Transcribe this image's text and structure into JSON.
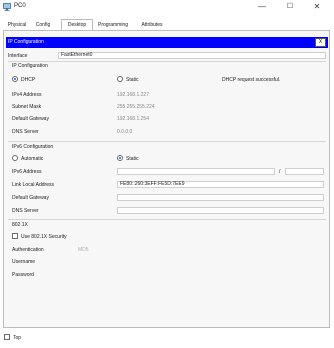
{
  "window": {
    "title": "PC0",
    "minimize": "—",
    "maximize": "☐",
    "close": "✕"
  },
  "tabs": [
    "Physical",
    "Config",
    "Desktop",
    "Programming",
    "Attributes"
  ],
  "ip_config": {
    "header": "IP Configuration",
    "close_label": "X",
    "interface_label": "Interface",
    "interface_value": "FastEthernet0",
    "ipv4_section": "IP Configuration",
    "dhcp_label": "DHCP",
    "static_label": "Static",
    "dhcp_status": "DHCP request successful.",
    "ipv4_address_label": "IPv4 Address",
    "ipv4_address_value": "192.168.1.227",
    "subnet_mask_label": "Subnet Mask",
    "subnet_mask_value": "255.255.255.224",
    "default_gateway_label": "Default Gateway",
    "default_gateway_value": "192.168.1.254",
    "dns_server_label": "DNS Server",
    "dns_server_value": "0.0.0.0",
    "ipv6_section": "IPv6 Configuration",
    "automatic_label": "Automatic",
    "static6_label": "Static",
    "ipv6_address_label": "IPv6 Address",
    "ipv6_address_value": "",
    "prefix_separator": "/",
    "prefix_value": "",
    "link_local_label": "Link Local Address",
    "link_local_value": "FE80::260:3EFF:FE5D:7EE9",
    "gateway6_label": "Default Gateway",
    "gateway6_value": "",
    "dns6_label": "DNS Server",
    "dns6_value": "",
    "dot1x_section": "802.1X",
    "use_dot1x_label": "Use 802.1X Security",
    "authentication_label": "Authentication",
    "authentication_value": "MD5",
    "username_label": "Username",
    "password_label": "Password"
  },
  "footer": {
    "top_label": "Top"
  },
  "selection": {
    "ipv4_mode": "DHCP",
    "ipv6_mode": "Static",
    "use_dot1x": false,
    "top": false
  },
  "colors": {
    "header_bar": "#0000ff",
    "radio_selected": "#1e63c8"
  }
}
